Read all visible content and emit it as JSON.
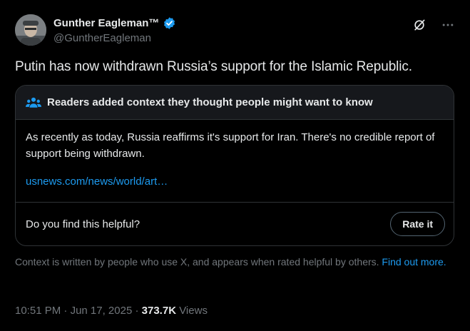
{
  "author": {
    "name": "Gunther Eagleman™",
    "handle": "@GuntherEagleman",
    "verified": true,
    "avatar_icon": "avatar"
  },
  "header_icons": [
    "grok-icon",
    "more-icon"
  ],
  "tweet": {
    "text": "Putin has now withdrawn Russia’s support for the Islamic Republic."
  },
  "community_note": {
    "title": "Readers added context they thought people might want to know",
    "title_icon": "people-icon",
    "text": "As recently as today, Russia reaffirms it's support for Iran. There's no credible report of support being withdrawn.",
    "link": "usnews.com/news/world/art…",
    "helpful_question": "Do you find this helpful?",
    "rate_button": "Rate it"
  },
  "disclaimer": {
    "text": "Context is written by people who use X, and appears when rated helpful by others.",
    "link": "Find out more."
  },
  "meta": {
    "time": "10:51 PM",
    "separator1": " · ",
    "date": "Jun 17, 2025",
    "separator2": " · ",
    "views_count": "373.7K",
    "views_label": " Views"
  },
  "colors": {
    "background": "#000000",
    "text": "#e7e9ea",
    "muted": "#71767b",
    "accent": "#1d9bf0",
    "border": "#2f3336"
  }
}
